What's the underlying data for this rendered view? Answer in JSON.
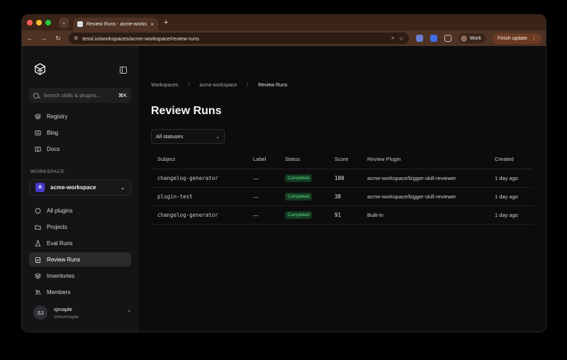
{
  "browser": {
    "tab_title": "Review Runs - acme-worksp...",
    "tab_close": "×",
    "new_tab": "+",
    "url": "tessl.io/workspaces/acme-workspace/review-runs",
    "profile_label": "Work",
    "finish_update_label": "Finish update"
  },
  "sidebar": {
    "search_placeholder": "Search skills & plugins...",
    "search_shortcut": "⌘K",
    "top_items": [
      {
        "label": "Registry",
        "icon": "layers-icon"
      },
      {
        "label": "Blog",
        "icon": "newspaper-icon"
      },
      {
        "label": "Docs",
        "icon": "book-icon"
      }
    ],
    "workspace_label": "WORKSPACE",
    "workspace": {
      "badge": "A",
      "name": "acme-workspace"
    },
    "workspace_items": [
      {
        "label": "All plugins",
        "icon": "circle-icon"
      },
      {
        "label": "Projects",
        "icon": "folder-icon"
      },
      {
        "label": "Eval Runs",
        "icon": "flask-icon"
      },
      {
        "label": "Review Runs",
        "icon": "clipboard-check-icon",
        "active": true
      },
      {
        "label": "Inventories",
        "icon": "layers-icon"
      },
      {
        "label": "Members",
        "icon": "users-icon"
      }
    ],
    "user": {
      "initials": "SJ",
      "name": "sjmaple",
      "handle": "simonmaple"
    }
  },
  "breadcrumb": {
    "items": [
      "Workspaces",
      "acme-workspace",
      "Review Runs"
    ],
    "separator": "/"
  },
  "page": {
    "title": "Review Runs",
    "filter_value": "All statuses"
  },
  "table": {
    "headers": [
      "Subject",
      "Label",
      "Status",
      "Score",
      "Review Plugin",
      "Created"
    ],
    "rows": [
      {
        "subject": "changelog-generator",
        "label": "—",
        "status": "Completed",
        "score": "100",
        "plugin": "acme-workspace/bigger-skill-reviewer",
        "created": "1 day ago"
      },
      {
        "subject": "plugin-test",
        "label": "—",
        "status": "Completed",
        "score": "38",
        "plugin": "acme-workspace/bigger-skill-reviewer",
        "created": "1 day ago"
      },
      {
        "subject": "changelog-generator",
        "label": "—",
        "status": "Completed",
        "score": "91",
        "plugin": "Built-in",
        "created": "1 day ago"
      }
    ]
  },
  "colors": {
    "status_completed_bg": "#143a22",
    "status_completed_fg": "#5fe08a",
    "workspace_badge": "#4a3bd1",
    "browser_chrome": "#4e3223"
  }
}
